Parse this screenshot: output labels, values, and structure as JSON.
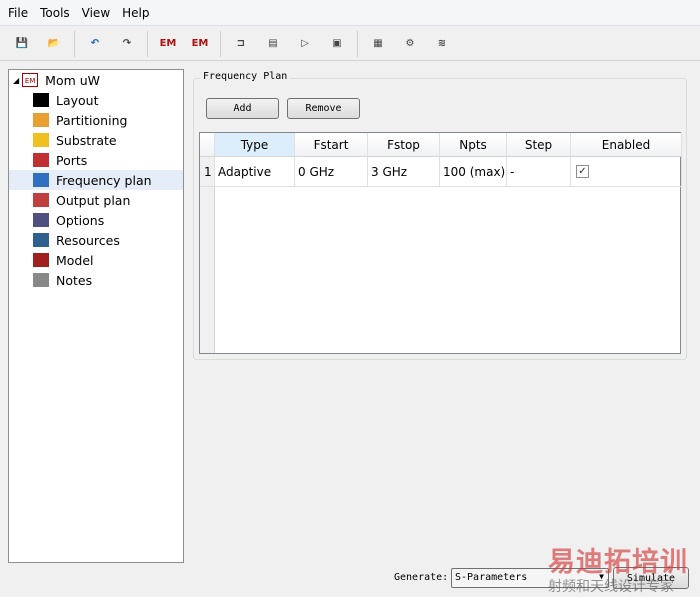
{
  "menu": [
    "File",
    "Tools",
    "View",
    "Help"
  ],
  "toolbar": [
    {
      "name": "save-icon",
      "glyph": "💾"
    },
    {
      "name": "open-icon",
      "glyph": "📂"
    },
    {
      "name": "undo-icon",
      "glyph": "↶"
    },
    {
      "name": "redo-icon",
      "glyph": "↷"
    },
    {
      "name": "em-settings-icon",
      "glyph": "EM"
    },
    {
      "name": "em-delete-icon",
      "glyph": "EM"
    },
    {
      "name": "layout-icon",
      "glyph": "⊐"
    },
    {
      "name": "substrate-icon",
      "glyph": "▤"
    },
    {
      "name": "port-icon",
      "glyph": "▷"
    },
    {
      "name": "box-icon",
      "glyph": "▣"
    },
    {
      "name": "spectrum-icon",
      "glyph": "▦"
    },
    {
      "name": "simulate-gear-icon",
      "glyph": "⚙"
    },
    {
      "name": "field-view-icon",
      "glyph": "≋"
    }
  ],
  "tree": {
    "root": "Mom uW",
    "items": [
      {
        "label": "Layout",
        "icon": "layout-icon",
        "color": "#000"
      },
      {
        "label": "Partitioning",
        "icon": "partitioning-icon",
        "color": "#e8a030"
      },
      {
        "label": "Substrate",
        "icon": "substrate-icon",
        "color": "#f0c020"
      },
      {
        "label": "Ports",
        "icon": "ports-icon",
        "color": "#c03030"
      },
      {
        "label": "Frequency plan",
        "icon": "frequency-icon",
        "color": "#3070c0"
      },
      {
        "label": "Output plan",
        "icon": "output-icon",
        "color": "#c04040"
      },
      {
        "label": "Options",
        "icon": "options-icon",
        "color": "#505080"
      },
      {
        "label": "Resources",
        "icon": "resources-icon",
        "color": "#306090"
      },
      {
        "label": "Model",
        "icon": "model-icon",
        "color": "#a02020"
      },
      {
        "label": "Notes",
        "icon": "notes-icon",
        "color": "#888"
      }
    ],
    "selected": 4
  },
  "frequency_plan": {
    "title": "Frequency Plan",
    "add": "Add",
    "remove": "Remove",
    "columns": [
      "Type",
      "Fstart",
      "Fstop",
      "Npts",
      "Step",
      "Enabled"
    ],
    "rows": [
      {
        "num": "1",
        "type": "Adaptive",
        "fstart": "0 GHz",
        "fstop": "3 GHz",
        "npts": "100 (max)",
        "step": "-",
        "enabled": true
      }
    ]
  },
  "footer": {
    "generate_label": "Generate:",
    "generate_value": "S-Parameters",
    "simulate": "Simulate"
  },
  "watermark": {
    "line1": "易迪拓培训",
    "line2": "射频和天线设计专家"
  }
}
